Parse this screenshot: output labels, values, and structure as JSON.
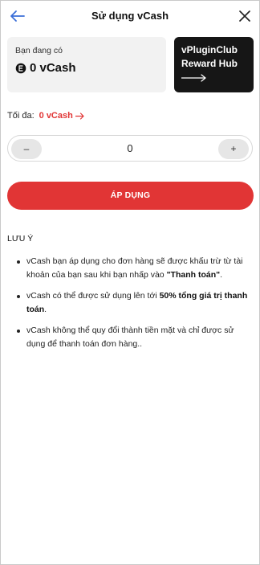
{
  "header": {
    "title": "Sử dụng vCash",
    "back_icon": "arrow-left-icon",
    "back_color": "#3b6fd8",
    "close_icon": "close-icon"
  },
  "balance": {
    "label": "Bạn đang có",
    "value": "0 vCash",
    "icon": "vcash-coin-icon"
  },
  "reward_hub": {
    "line1": "vPluginClub",
    "line2": "Reward Hub",
    "icon": "arrow-right-long-icon",
    "background": "#161616"
  },
  "max": {
    "label": "Tối đa:",
    "value": "0 vCash",
    "icon": "arrow-right-icon",
    "color": "#e13535"
  },
  "stepper": {
    "minus_label": "–",
    "value": "0",
    "plus_label": "+"
  },
  "apply_button": {
    "label": "ÁP DỤNG",
    "color": "#e13535"
  },
  "notes": {
    "title": "LƯU Ý",
    "items": [
      {
        "pre": "vCash bạn áp dụng cho đơn hàng sẽ được khấu trừ từ tài khoản của bạn sau khi bạn nhấp vào ",
        "bold": "\"Thanh toán\"",
        "post": "."
      },
      {
        "pre": "vCash có thể được sử dụng lên tới ",
        "bold": "50% tổng giá trị thanh toán",
        "post": "."
      },
      {
        "pre": "vCash không thể quy đổi thành tiền mặt và chỉ được sử dụng để thanh toán đơn hàng..",
        "bold": "",
        "post": ""
      }
    ]
  }
}
